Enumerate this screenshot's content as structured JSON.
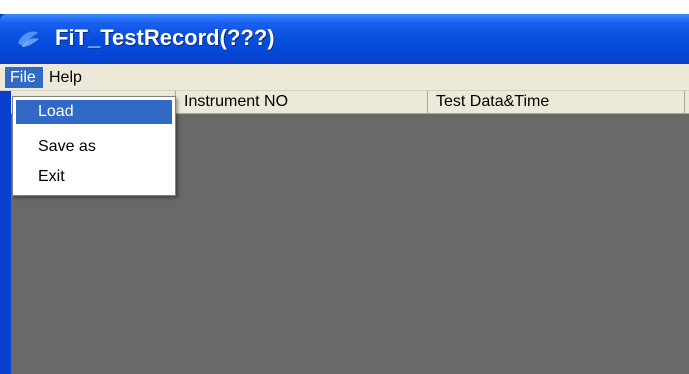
{
  "window": {
    "title": "FiT_TestRecord(???)",
    "icon": "app-logo-icon"
  },
  "menubar": {
    "items": [
      {
        "label": "File",
        "active": true
      },
      {
        "label": "Help",
        "active": false
      }
    ]
  },
  "file_menu": {
    "items": [
      {
        "label": "Load",
        "highlighted": true
      },
      {
        "label": "Save as",
        "highlighted": false
      },
      {
        "label": "Exit",
        "highlighted": false
      }
    ]
  },
  "table": {
    "columns": [
      "",
      "Instrument NO",
      "Test Data&Time"
    ],
    "rows": []
  },
  "colors": {
    "titlebar": "#0546d6",
    "menu_highlight": "#316ac5",
    "grid_background": "#696969",
    "chrome": "#ece9d8"
  }
}
